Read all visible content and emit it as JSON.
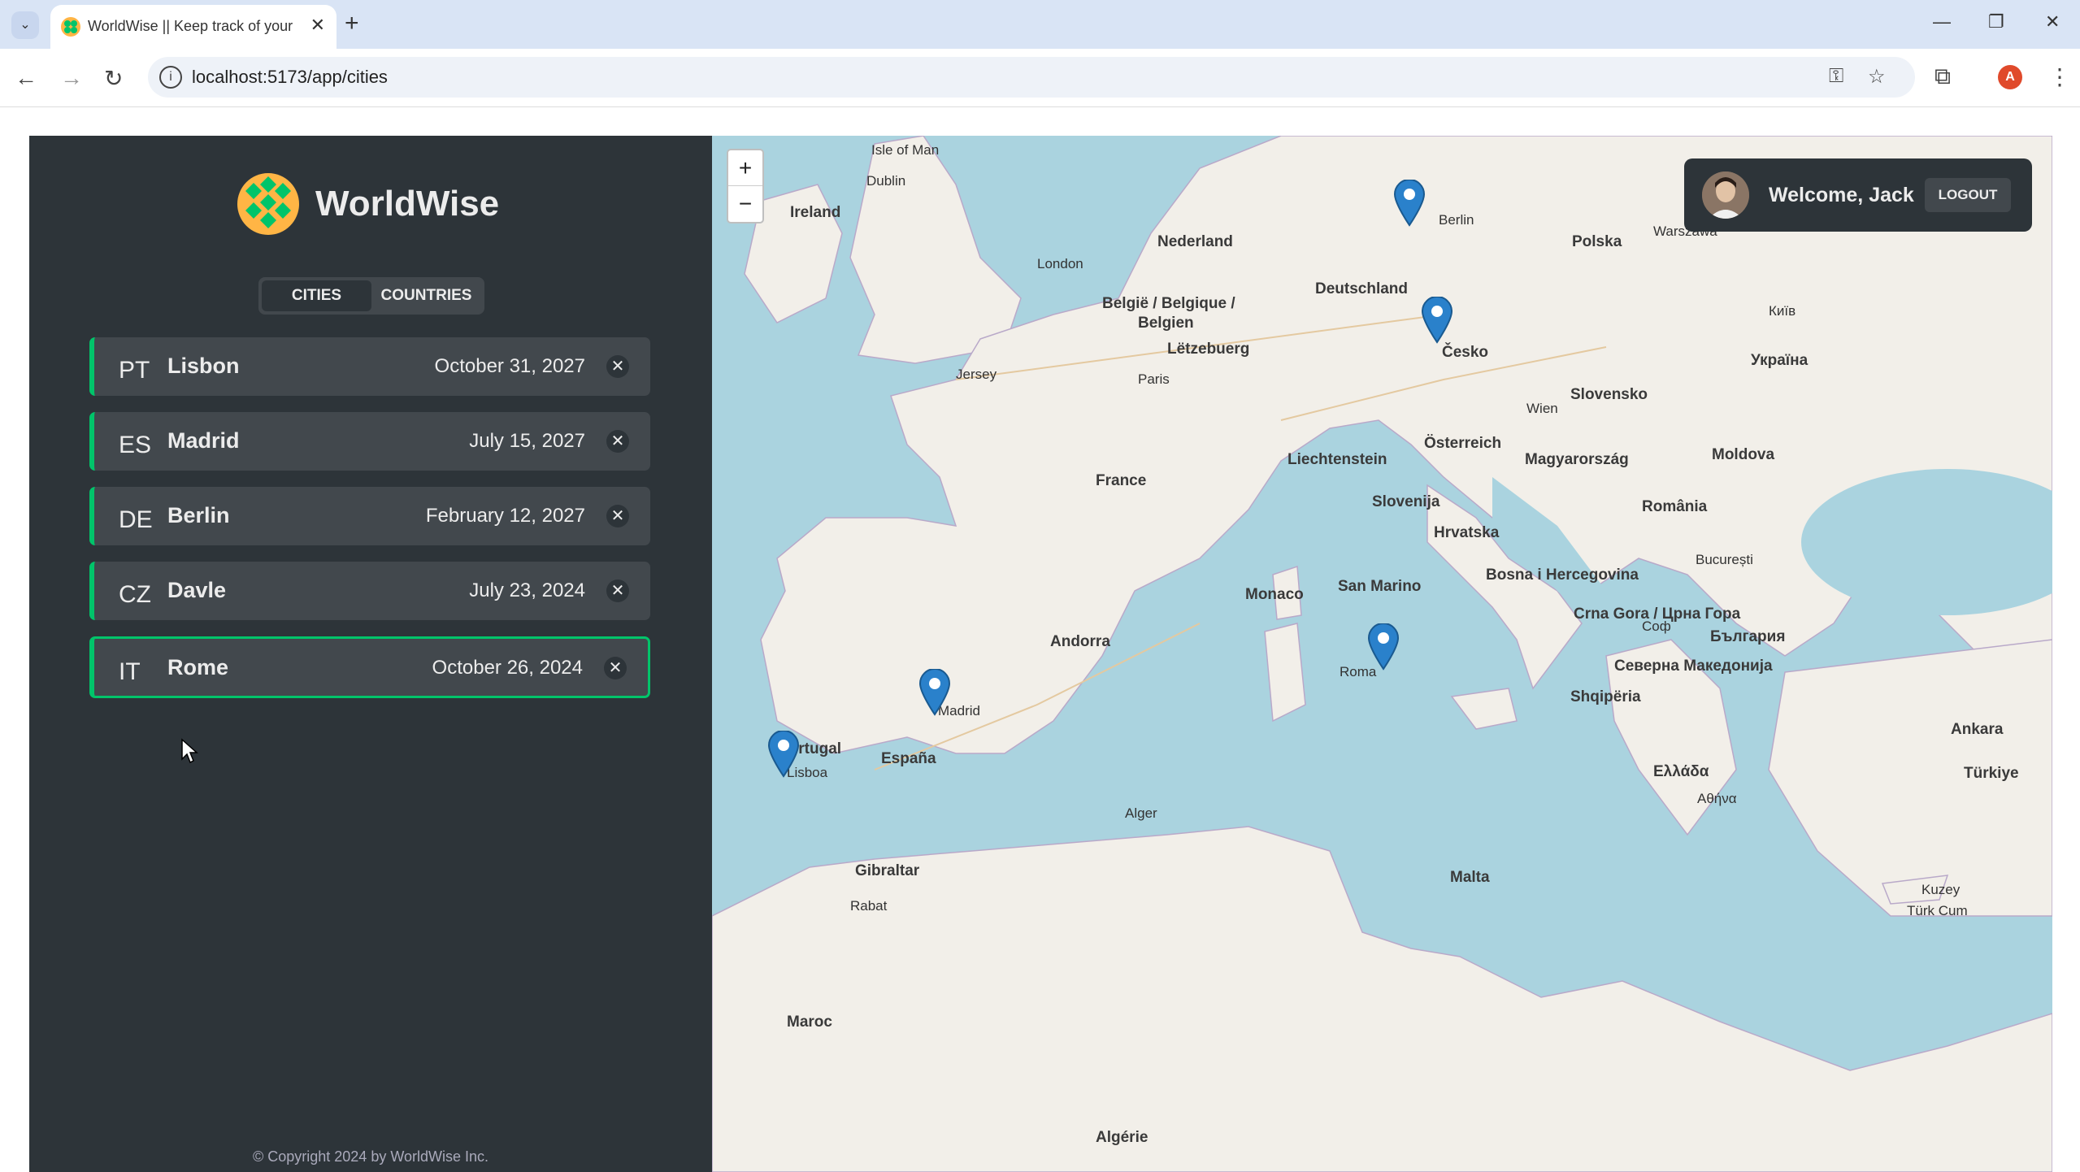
{
  "browser": {
    "tab_title": "WorldWise || Keep track of your",
    "url": "localhost:5173/app/cities",
    "profile_initial": "A"
  },
  "app": {
    "name": "WorldWise",
    "tabs": [
      "CITIES",
      "COUNTRIES"
    ],
    "active_tab": "CITIES",
    "cities": [
      {
        "code": "PT",
        "name": "Lisbon",
        "date": "October 31, 2027"
      },
      {
        "code": "ES",
        "name": "Madrid",
        "date": "July 15, 2027"
      },
      {
        "code": "DE",
        "name": "Berlin",
        "date": "February 12, 2027"
      },
      {
        "code": "CZ",
        "name": "Davle",
        "date": "July 23, 2024"
      },
      {
        "code": "IT",
        "name": "Rome",
        "date": "October 26, 2024"
      }
    ],
    "copyright": "© Copyright 2024 by WorldWise Inc.",
    "accent_color": "#00c46a"
  },
  "user": {
    "welcome": "Welcome, Jack",
    "logout_label": "LOGOUT"
  },
  "map": {
    "zoom_in": "+",
    "zoom_out": "−",
    "labels": {
      "isle_of_man": "Isle of Man",
      "dublin": "Dublin",
      "ireland": "Ireland",
      "london": "London",
      "nederland": "Nederland",
      "deutschland": "Deutschland",
      "berlin": "Berlin",
      "polska": "Polska",
      "warszawa": "Warszawa",
      "belgie": "België / Belgique /",
      "belgien": "Belgien",
      "letzebuerg": "Lëtzebuerg",
      "cesko": "Česko",
      "jersey": "Jersey",
      "paris": "Paris",
      "slovensko": "Slovensko",
      "wien": "Wien",
      "osterreich": "Österreich",
      "liechtenstein": "Liechtenstein",
      "magyarorszag": "Magyarország",
      "france": "France",
      "slovenija": "Slovenija",
      "hrvatska": "Hrvatska",
      "moldova": "Moldova",
      "romania": "România",
      "bucuresti": "București",
      "kyiv": "Київ",
      "ukraina": "Україна",
      "monaco": "Monaco",
      "san_marino": "San Marino",
      "bosna": "Bosna i Hercegovina",
      "crna_gora": "Crna Gora / Црна Гора",
      "sof": "Соф",
      "srbija": "Северна Македонија",
      "shqiperia": "Shqipëria",
      "bulgaria": "България",
      "andorra": "Andorra",
      "portugal": "Portugal",
      "lisboa": "Lisboa",
      "madrid": "Madrid",
      "espana": "España",
      "roma": "Roma",
      "ellada": "Ελλάδα",
      "athina": "Αθήνα",
      "ankara": "Ankara",
      "turkiye": "Türkiye",
      "gibraltar": "Gibraltar",
      "alger": "Alger",
      "malta": "Malta",
      "rabat": "Rabat",
      "maroc": "Maroc",
      "algerie": "Algérie",
      "kuzey": "Kuzey",
      "turk_cum": "Türk Cum"
    }
  }
}
